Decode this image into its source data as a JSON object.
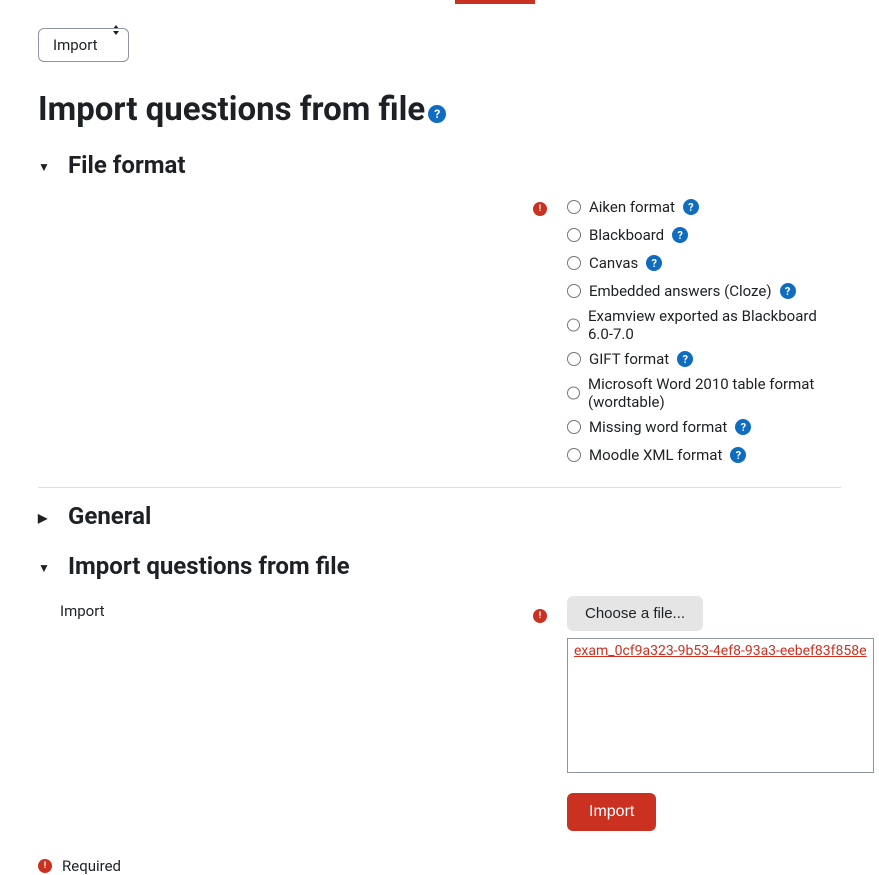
{
  "dropdown": {
    "selected": "Import"
  },
  "page": {
    "title": "Import questions from file"
  },
  "sections": {
    "file_format": {
      "title": "File format",
      "expanded": true,
      "options": [
        {
          "label": "Aiken format",
          "help": true
        },
        {
          "label": "Blackboard",
          "help": true
        },
        {
          "label": "Canvas",
          "help": true
        },
        {
          "label": "Embedded answers (Cloze)",
          "help": true
        },
        {
          "label": "Examview exported as Blackboard 6.0-7.0",
          "help": false
        },
        {
          "label": "GIFT format",
          "help": true
        },
        {
          "label": "Microsoft Word 2010 table format (wordtable)",
          "help": false
        },
        {
          "label": "Missing word format",
          "help": true
        },
        {
          "label": "Moodle XML format",
          "help": true
        }
      ]
    },
    "general": {
      "title": "General",
      "expanded": false
    },
    "import_file": {
      "title": "Import questions from file",
      "expanded": true,
      "field_label": "Import",
      "choose_label": "Choose a file...",
      "file_name": "exam_0cf9a323-9b53-4ef8-93a3-eebef83f858e"
    }
  },
  "submit": {
    "label": "Import"
  },
  "required_text": "Required"
}
